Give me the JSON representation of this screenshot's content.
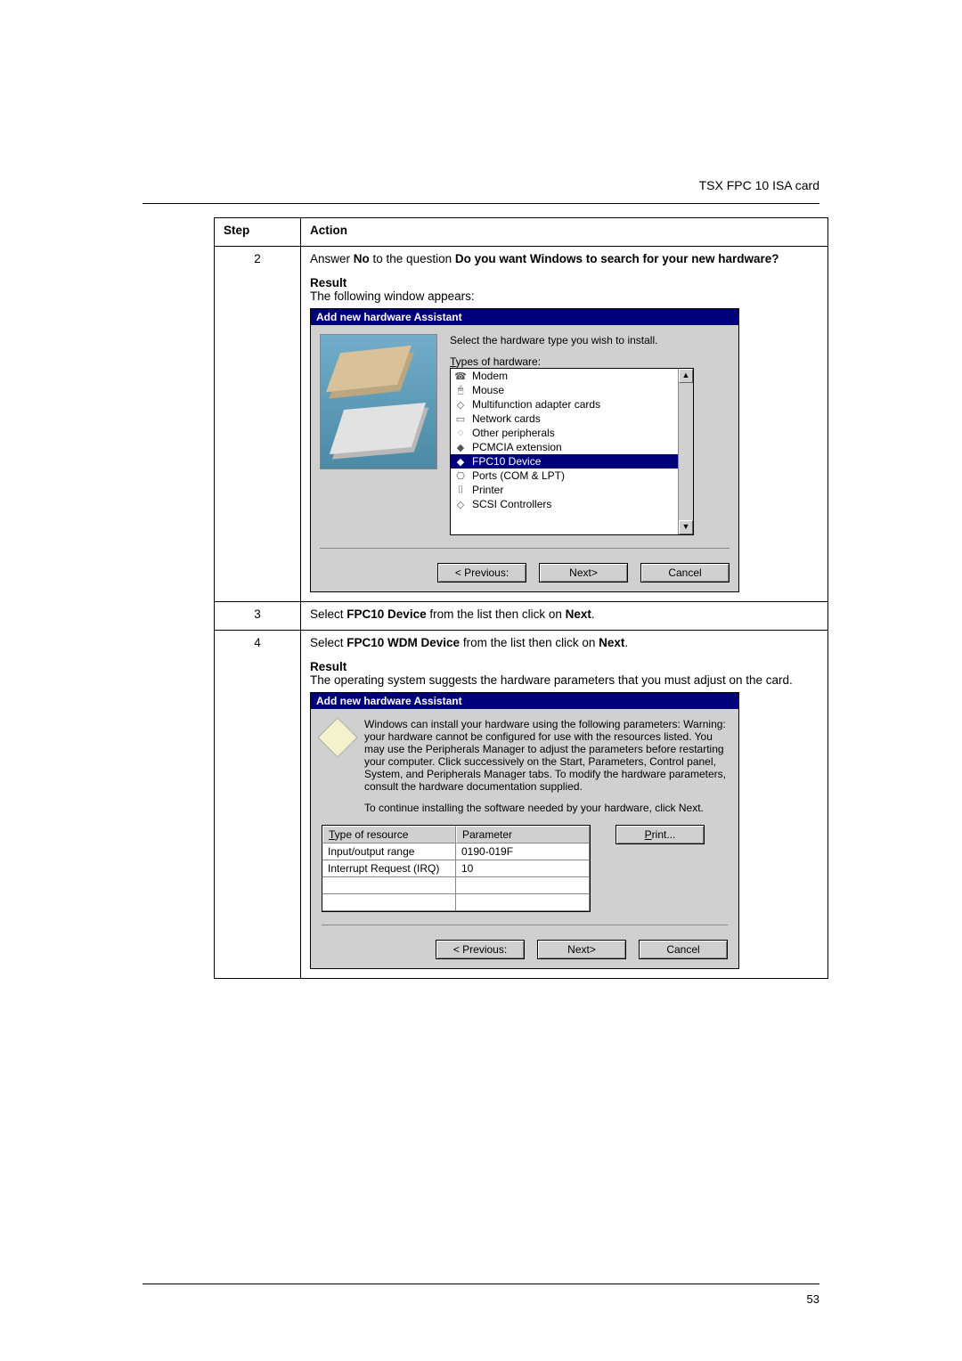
{
  "header": {
    "doc_title": "TSX FPC 10 ISA card"
  },
  "footer": {
    "page_number": "53"
  },
  "table": {
    "head_step": "Step",
    "head_action": "Action",
    "rows": [
      {
        "num": "2",
        "line1_a": "Answer ",
        "line1_no": "No",
        "line1_b": " to the question ",
        "line1_q": "Do you want Windows to search for your new hardware?",
        "result_label": "Result",
        "result_text": "The following window appears:",
        "wizard": {
          "title": "Add new hardware Assistant",
          "instr": "Select the hardware type you wish to install.",
          "types_label": "Types of hardware:",
          "items": [
            "Modem",
            "Mouse",
            "Multifunction adapter cards",
            "Network cards",
            "Other peripherals",
            "PCMCIA extension",
            "FPC10 Device",
            "Ports (COM & LPT)",
            "Printer",
            "SCSI Controllers"
          ],
          "btn_prev": "< Previous:",
          "btn_next": "Next>",
          "btn_cancel": "Cancel"
        }
      },
      {
        "num": "3",
        "a": "Select ",
        "b": "FPC10 Device",
        "c": " from the list then click on ",
        "d": "Next",
        "e": "."
      },
      {
        "num": "4",
        "a": "Select ",
        "b": "FPC10 WDM Device",
        "c": " from the list then click on ",
        "d": "Next",
        "e": ".",
        "result_label": "Result",
        "result_text": "The operating system suggests the hardware parameters that you must adjust on the card.",
        "wizard": {
          "title": "Add new hardware Assistant",
          "body": "Windows can install your hardware using the following parameters: Warning: your hardware cannot be configured for use with the resources listed. You may use the Peripherals Manager to adjust the parameters before restarting your computer. Click successively on the Start, Parameters, Control panel, System, and Peripherals Manager tabs. To modify the hardware parameters, consult the hardware documentation supplied.",
          "continue": "To continue installing the software needed by your hardware, click Next.",
          "print": "Print...",
          "col_type": "Type of resource",
          "col_param": "Parameter",
          "r1a": "Input/output range",
          "r1b": "0190-019F",
          "r2a": "Interrupt Request (IRQ)",
          "r2b": "10",
          "btn_prev": "< Previous:",
          "btn_next": "Next>",
          "btn_cancel": "Cancel"
        }
      }
    ]
  }
}
